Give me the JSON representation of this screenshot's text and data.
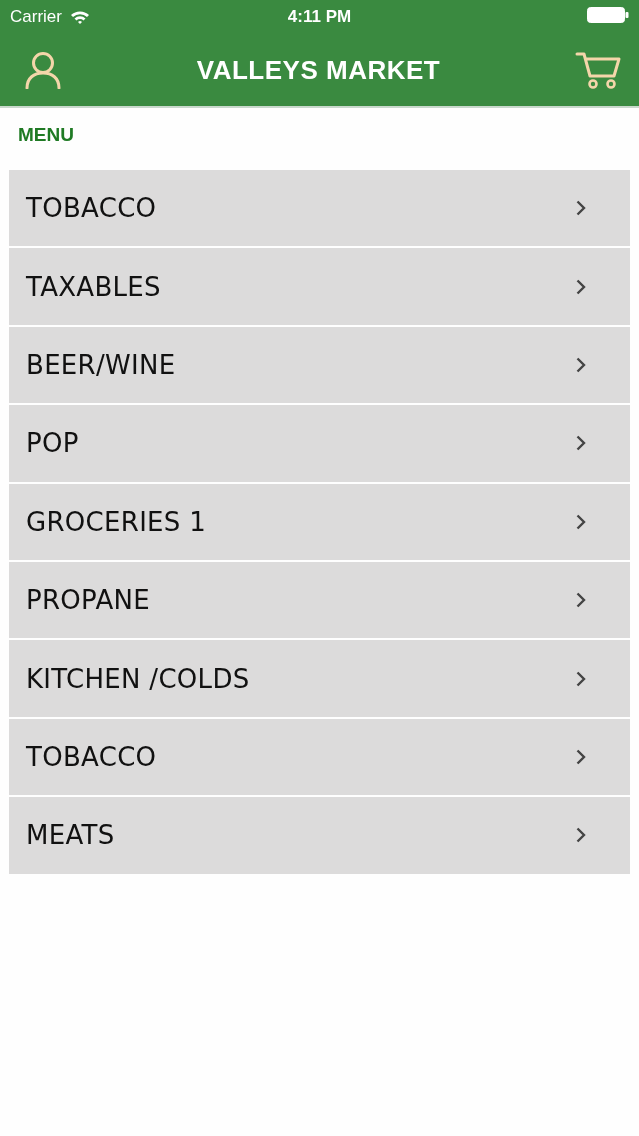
{
  "status_bar": {
    "carrier": "Carrier",
    "time": "4:11 PM"
  },
  "nav_bar": {
    "title": "VALLEYS MARKET"
  },
  "section_title": "MENU",
  "menu_items": [
    {
      "label": "TOBACCO"
    },
    {
      "label": "TAXABLES"
    },
    {
      "label": "BEER/WINE"
    },
    {
      "label": "POP"
    },
    {
      "label": "GROCERIES 1"
    },
    {
      "label": "PROPANE"
    },
    {
      "label": "KITCHEN /COLDS"
    },
    {
      "label": "TOBACCO"
    },
    {
      "label": "MEATS"
    }
  ]
}
